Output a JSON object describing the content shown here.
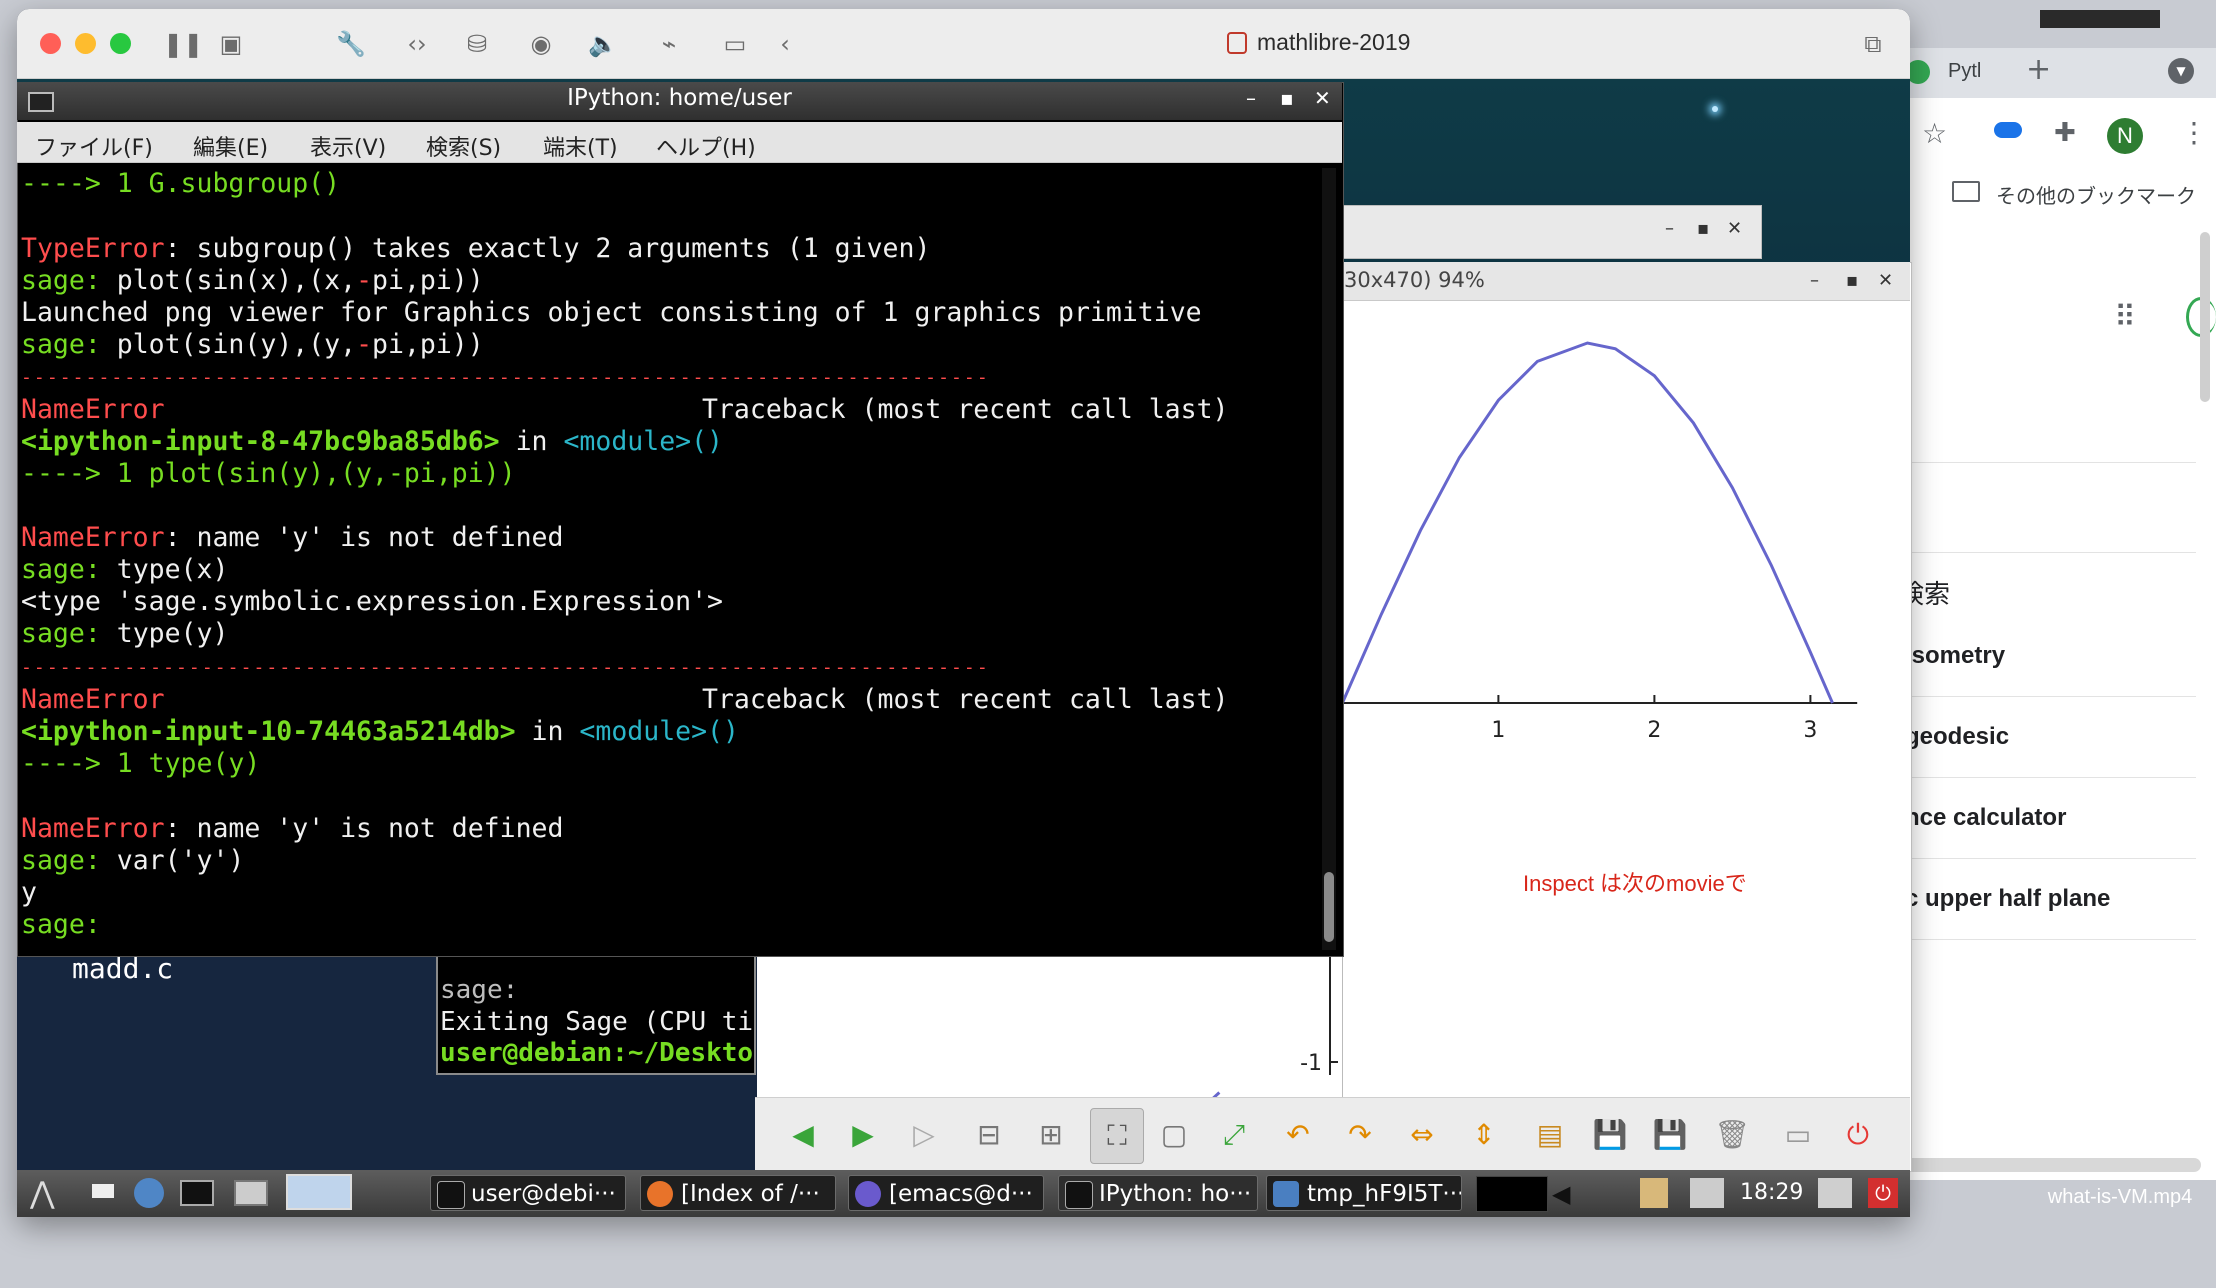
{
  "vm": {
    "title": "mathlibre-2019"
  },
  "chrome": {
    "tab_label": "Pytl",
    "new_tab": "+",
    "avatar_letter": "N",
    "bookmark_label": "その他のブックマーク",
    "search_heading": "検索",
    "search_items": [
      "isometry",
      "geodesic",
      "nce calculator",
      "c upper half plane"
    ]
  },
  "terminal": {
    "title": "IPython: home/user",
    "menu": [
      "ファイル(F)",
      "編集(E)",
      "表示(V)",
      "検索(S)",
      "端末(T)",
      "ヘルプ(H)"
    ],
    "lines": {
      "l1": "----> 1 G.subgroup()",
      "l2_err": "TypeError",
      "l2_msg": ": subgroup() takes exactly 2 arguments (1 given)",
      "l3_prompt": "sage:",
      "l3_a": " plot(sin(x),(x,",
      "l3_minus": "-",
      "l3_b": "pi,pi))",
      "l4": "Launched png viewer for Graphics object consisting of 1 graphics primitive",
      "l5_prompt": "sage:",
      "l5_a": " plot(sin(y),(y,",
      "l5_minus": "-",
      "l5_b": "pi,pi))",
      "dashes": "---------------------------------------------------------------------------",
      "l6_err": "NameError",
      "l6_tb": "Traceback (most recent call last)",
      "l7_input": "<ipython-input-8-47bc9ba85db6>",
      "l7_in": " in ",
      "l7_mod": "<module>()",
      "l8": "----> 1 plot(sin(y),(y,-pi,pi))",
      "l9_err": "NameError",
      "l9_msg": ": name 'y' is not defined",
      "l10_prompt": "sage:",
      "l10": " type(x)",
      "l11": "<type 'sage.symbolic.expression.Expression'>",
      "l12_prompt": "sage:",
      "l12": " type(y)",
      "l13_err": "NameError",
      "l13_tb": "Traceback (most recent call last)",
      "l14_input": "<ipython-input-10-74463a5214db>",
      "l14_in": " in ",
      "l14_mod": "<module>()",
      "l15": "----> 1 type(y)",
      "l16_err": "NameError",
      "l16_msg": ": name 'y' is not defined",
      "l17_prompt": "sage:",
      "l17": " var('y')",
      "l18": "y",
      "l19_prompt": "sage:"
    }
  },
  "bg_terminal": {
    "file_label": "madd.c",
    "line1": "sage:",
    "line2": "Exiting Sage (CPU ti",
    "line3": "user@debian:~/Deskto"
  },
  "viewer": {
    "title": "30x470) 94%",
    "inspect_note": "Inspect は次のmovieで"
  },
  "chart_data": {
    "type": "line",
    "series": [
      {
        "x": [
          0,
          0.25,
          0.5,
          0.75,
          1.0,
          1.25,
          1.5708,
          1.75,
          2.0,
          2.25,
          2.5,
          2.75,
          3.0,
          3.14159
        ],
        "y": [
          0,
          0.247,
          0.479,
          0.682,
          0.841,
          0.949,
          1.0,
          0.984,
          0.909,
          0.778,
          0.598,
          0.382,
          0.141,
          0
        ]
      }
    ],
    "x_ticks": [
      "1",
      "2",
      "3"
    ],
    "y_ticks": [
      "-1"
    ],
    "xlim": [
      -3.14159,
      3.14159
    ],
    "ylim": [
      -1,
      1
    ],
    "color": "#6666cc"
  },
  "taskbar": {
    "items": [
      "user@debi···",
      "[Index of /···",
      "[emacs@d···",
      "IPython: ho···",
      "tmp_hF9I5T···"
    ],
    "clock": "18:29"
  },
  "host": {
    "file_label": "what-is-VM.mp4"
  }
}
